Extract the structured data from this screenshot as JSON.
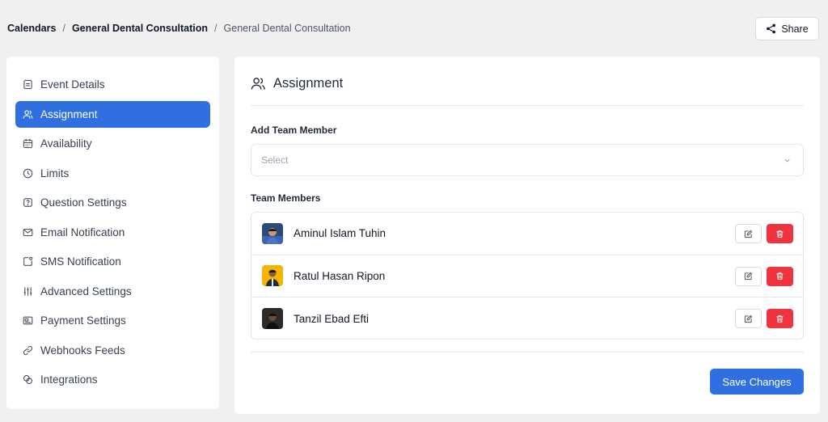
{
  "breadcrumb": {
    "root": "Calendars",
    "parent": "General Dental Consultation",
    "current": "General Dental Consultation",
    "separator": "/"
  },
  "header": {
    "share_label": "Share"
  },
  "sidebar": {
    "active_index": 1,
    "items": [
      {
        "label": "Event Details",
        "icon": "document-icon"
      },
      {
        "label": "Assignment",
        "icon": "users-icon"
      },
      {
        "label": "Availability",
        "icon": "calendar-icon"
      },
      {
        "label": "Limits",
        "icon": "clock-icon"
      },
      {
        "label": "Question Settings",
        "icon": "question-icon"
      },
      {
        "label": "Email Notification",
        "icon": "mail-icon"
      },
      {
        "label": "SMS Notification",
        "icon": "sms-icon"
      },
      {
        "label": "Advanced Settings",
        "icon": "sliders-icon"
      },
      {
        "label": "Payment Settings",
        "icon": "payment-icon"
      },
      {
        "label": "Webhooks Feeds",
        "icon": "link-icon"
      },
      {
        "label": "Integrations",
        "icon": "integrations-icon"
      }
    ]
  },
  "main": {
    "title": "Assignment",
    "add_member_label": "Add Team Member",
    "select_placeholder": "Select",
    "team_members_label": "Team Members",
    "members": [
      {
        "name": "Aminul Islam Tuhin"
      },
      {
        "name": "Ratul Hasan Ripon"
      },
      {
        "name": "Tanzil Ebad Efti"
      }
    ],
    "save_label": "Save Changes"
  },
  "colors": {
    "accent": "#2f6fdf",
    "danger": "#f0343f",
    "background": "#f0f0f1"
  }
}
